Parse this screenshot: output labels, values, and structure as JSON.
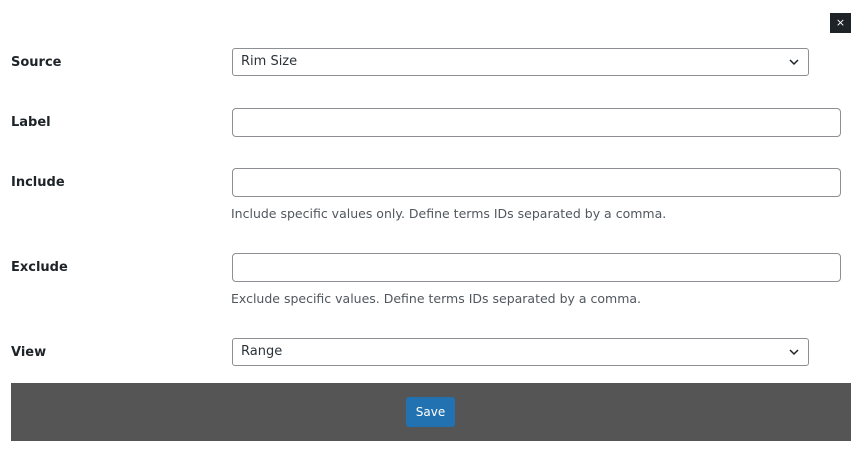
{
  "dialog": {
    "close_label": "×"
  },
  "fields": {
    "source": {
      "label": "Source",
      "selected": "Rim Size"
    },
    "label": {
      "label": "Label",
      "value": ""
    },
    "include": {
      "label": "Include",
      "value": "",
      "help": "Include specific values only. Define terms IDs separated by a comma."
    },
    "exclude": {
      "label": "Exclude",
      "value": "",
      "help": "Exclude specific values. Define terms IDs separated by a comma."
    },
    "view": {
      "label": "View",
      "selected": "Range"
    }
  },
  "footer": {
    "save_label": "Save"
  },
  "icons": {
    "close": "close-icon",
    "chevron": "chevron-down-icon"
  },
  "colors": {
    "primary_button": "#2271b1",
    "footer_bg": "#555555",
    "close_bg": "#1d2327"
  }
}
